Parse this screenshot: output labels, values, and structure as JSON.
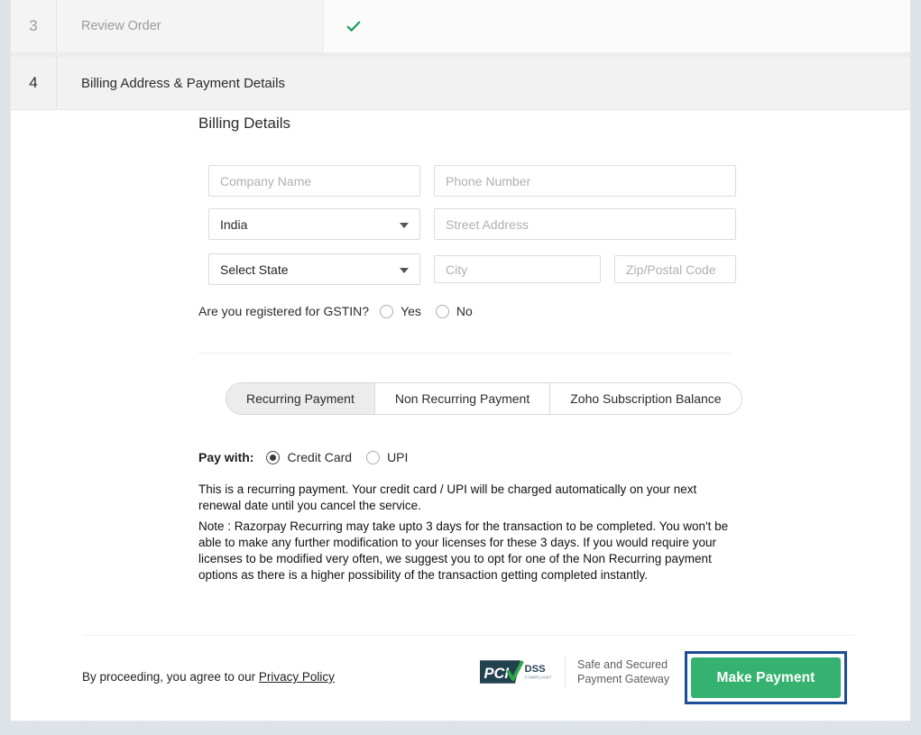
{
  "steps": [
    {
      "number": "3",
      "title": "Review Order",
      "state_icon": "check-icon",
      "completed": true
    },
    {
      "number": "4",
      "title": "Billing Address & Payment Details",
      "state_icon": "",
      "completed": false
    }
  ],
  "billing": {
    "heading": "Billing Details",
    "fields": {
      "company": {
        "placeholder": "Company Name",
        "value": ""
      },
      "phone": {
        "placeholder": "Phone Number",
        "value": ""
      },
      "country": {
        "value": "India",
        "icon": "chevron-down-icon"
      },
      "street": {
        "placeholder": "Street Address",
        "value": ""
      },
      "state": {
        "value": "Select State",
        "icon": "chevron-down-icon"
      },
      "city": {
        "placeholder": "City",
        "value": ""
      },
      "zip": {
        "placeholder": "Zip/Postal Code",
        "value": ""
      }
    },
    "gstin": {
      "label": "Are you registered for GSTIN?",
      "options": [
        {
          "label": "Yes",
          "selected": false
        },
        {
          "label": "No",
          "selected": false
        }
      ]
    }
  },
  "payment": {
    "tabs": [
      {
        "label": "Recurring Payment",
        "active": true
      },
      {
        "label": "Non Recurring Payment",
        "active": false
      },
      {
        "label": "Zoho Subscription Balance",
        "active": false
      }
    ],
    "pay_with_label": "Pay with:",
    "methods": [
      {
        "label": "Credit Card",
        "selected": true
      },
      {
        "label": "UPI",
        "selected": false
      }
    ],
    "note_1": "This is a recurring payment. Your credit card / UPI will be charged automatically on your next renewal date until you cancel the service.",
    "note_2": "Note : Razorpay Recurring may take upto 3 days for the transaction to be completed. You won't be able to make any further modification to your licenses for these 3 days. If you would require your licenses to be modified very often, we suggest you to opt for one of the Non Recurring payment options as there is a higher possibility of the transaction getting completed instantly."
  },
  "footer": {
    "agree_prefix": "By proceeding, you agree to our ",
    "privacy_policy_label": "Privacy Policy",
    "badge": {
      "logo_pci": "PCI",
      "logo_dss": "DSS",
      "logo_compliant": "COMPLIANT",
      "line1": "Safe and Secured",
      "line2": "Payment Gateway"
    },
    "make_payment_label": "Make Payment"
  },
  "colors": {
    "page_background": "#dde3e8",
    "accent_green": "#35b26f",
    "check_green": "#1a9e5c",
    "focus_blue": "#1d4d99",
    "pci_navy": "#1f3c4d",
    "text_dark": "#1f1f1f",
    "text_muted": "#9b9b9b"
  }
}
